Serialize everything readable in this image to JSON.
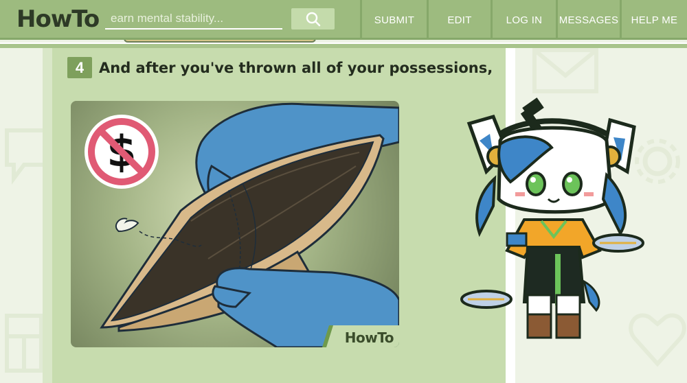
{
  "header": {
    "logo_part1": "How",
    "logo_part2": "To",
    "search_placeholder": "earn mental stability...",
    "search_button_icon": "search-icon",
    "nav": [
      {
        "label": "SUBMIT"
      },
      {
        "label": "EDIT"
      },
      {
        "label": "LOG IN"
      },
      {
        "label": "MESSAGES"
      },
      {
        "label": "HELP ME"
      }
    ]
  },
  "step": {
    "number": "4",
    "text": "And after you've thrown all of your possessions,",
    "image_icons": [
      "no-money-icon",
      "empty-wallet",
      "moth"
    ],
    "watermark_part1": "How",
    "watermark_part2": "To"
  },
  "colors": {
    "header_bg": "#9dbb7f",
    "main_bg": "#c7dcae",
    "badge_bg": "#7ea05c",
    "page_bg": "#eef3e6",
    "no_sign_red": "#e05a74"
  },
  "decorations": [
    "envelope-icon",
    "gear-icon",
    "heart-icon",
    "chat-bubble-icon",
    "mascot-character"
  ]
}
